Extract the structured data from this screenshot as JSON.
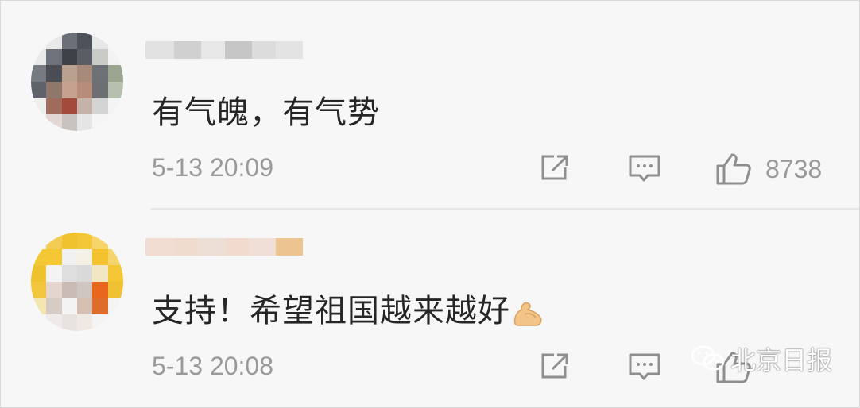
{
  "comments": [
    {
      "text": "有气魄，有气势",
      "time": "5-13 20:09",
      "likes": "8738",
      "share_icon": "share-icon",
      "reply_icon": "comment-icon",
      "like_icon": "thumbs-up-icon"
    },
    {
      "text": "支持！希望祖国越来越好",
      "time": "5-13 20:08",
      "likes": "",
      "emoji": "flexed-biceps",
      "share_icon": "share-icon",
      "reply_icon": "comment-icon",
      "like_icon": "thumbs-up-icon"
    }
  ],
  "watermark": {
    "text": "北京日报",
    "icon": "wechat-icon"
  },
  "colors": {
    "background": "#f7f7f7",
    "text": "#262626",
    "meta": "#9a9a9a",
    "avatar2_accent": "#f2c22e"
  }
}
